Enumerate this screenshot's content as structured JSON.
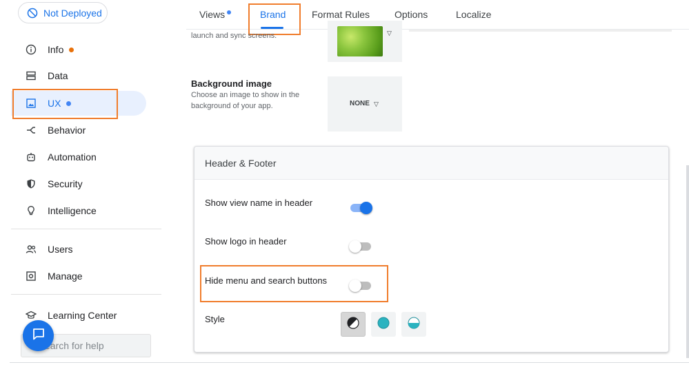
{
  "deploy_status": {
    "label": "Not Deployed",
    "icon": "not-deployed-icon"
  },
  "sidebar": {
    "items": [
      {
        "label": "Info",
        "icon": "info-icon",
        "badge": "orange-dot"
      },
      {
        "label": "Data",
        "icon": "data-icon"
      },
      {
        "label": "UX",
        "icon": "ux-image-icon",
        "badge": "blue-dot",
        "active": true
      },
      {
        "label": "Behavior",
        "icon": "behavior-icon"
      },
      {
        "label": "Automation",
        "icon": "automation-robot-icon"
      },
      {
        "label": "Security",
        "icon": "shield-icon"
      },
      {
        "label": "Intelligence",
        "icon": "lightbulb-icon"
      },
      {
        "label": "Users",
        "icon": "users-icon"
      },
      {
        "label": "Manage",
        "icon": "manage-icon"
      },
      {
        "label": "Learning Center",
        "icon": "graduation-cap-icon"
      }
    ],
    "help_placeholder": "earch for help"
  },
  "tabs": [
    {
      "label": "Views",
      "badge": "blue-dot"
    },
    {
      "label": "Brand",
      "active": true
    },
    {
      "label": "Format Rules"
    },
    {
      "label": "Options"
    },
    {
      "label": "Localize"
    }
  ],
  "brand": {
    "launch_desc_partial": "launch and sync screens.",
    "background_image": {
      "title": "Background image",
      "desc_line1": "Choose an image to show in the",
      "desc_line2": "background of your app.",
      "value": "NONE"
    },
    "header_footer": {
      "title": "Header & Footer",
      "rows": [
        {
          "label": "Show view name in header",
          "on": true
        },
        {
          "label": "Show logo in header",
          "on": false
        },
        {
          "label": "Hide menu and search buttons",
          "on": false
        }
      ],
      "style_label": "Style",
      "style_options": [
        "half-contrast-icon",
        "teal-circle-icon",
        "half-teal-circle-icon"
      ]
    }
  },
  "colors": {
    "accent": "#1a73e8",
    "highlight": "#f07c2b",
    "badge_orange": "#e8710a"
  }
}
